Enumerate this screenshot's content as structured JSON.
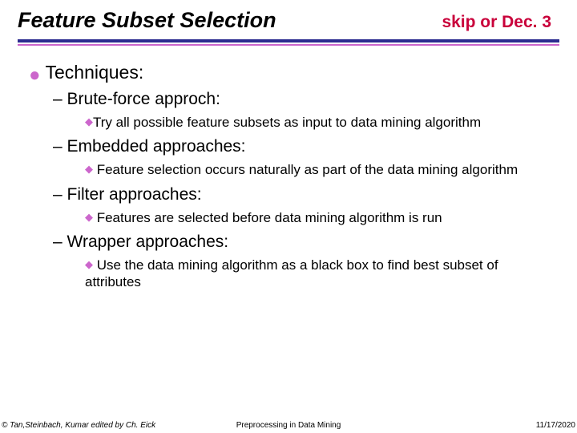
{
  "header": {
    "title": "Feature Subset Selection",
    "note": "skip or Dec. 3"
  },
  "content": {
    "sectionHeading": "Techniques:",
    "items": [
      {
        "heading": "Brute-force approch:",
        "detail": "Try all possible feature subsets as input to data mining algorithm"
      },
      {
        "heading": "Embedded approaches:",
        "detail": " Feature selection occurs naturally as part of the data mining algorithm"
      },
      {
        "heading": "Filter approaches:",
        "detail": " Features are selected before data mining algorithm is run"
      },
      {
        "heading": "Wrapper approaches:",
        "detail": " Use the data mining algorithm as a black box to find best subset of attributes"
      }
    ]
  },
  "footer": {
    "left": "© Tan,Steinbach, Kumar edited by Ch. Eick",
    "center": "Preprocessing in Data Mining",
    "right": "11/17/2020"
  }
}
